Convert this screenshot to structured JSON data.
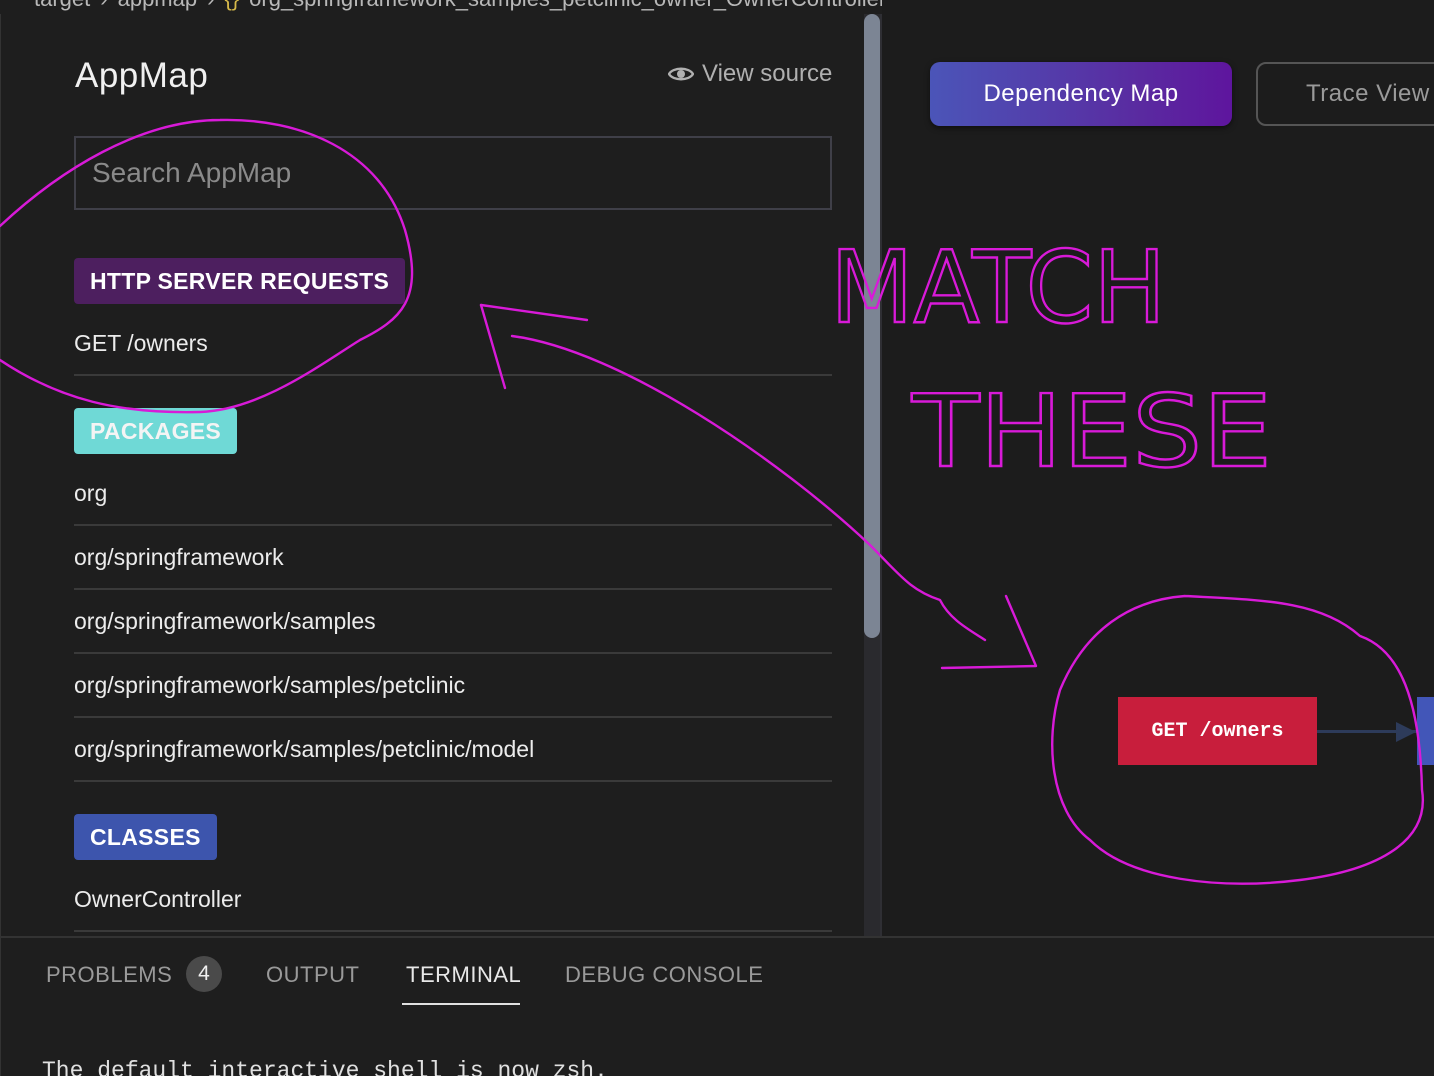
{
  "breadcrumb": {
    "parts": [
      "target",
      "appmap"
    ],
    "file": "org_springframework_samples_petclinic_owner_OwnerControllerTests_testProcessFindForm"
  },
  "appmap": {
    "title": "AppMap",
    "view_source": "View source",
    "search_placeholder": "Search AppMap"
  },
  "sections": {
    "http": {
      "label": "HTTP SERVER REQUESTS",
      "items": [
        "GET /owners"
      ]
    },
    "packages": {
      "label": "PACKAGES",
      "items": [
        "org",
        "org/springframework",
        "org/springframework/samples",
        "org/springframework/samples/petclinic",
        "org/springframework/samples/petclinic/model"
      ]
    },
    "classes": {
      "label": "CLASSES",
      "items": [
        "OwnerController"
      ]
    }
  },
  "views": {
    "dependency_map": "Dependency Map",
    "trace_view": "Trace View"
  },
  "diagram": {
    "node_label": "GET /owners"
  },
  "bottom_panel": {
    "tabs": {
      "problems": "PROBLEMS",
      "problems_count": "4",
      "output": "OUTPUT",
      "terminal": "TERMINAL",
      "debug_console": "DEBUG CONSOLE"
    },
    "terminal_line": "The default interactive shell is now zsh."
  },
  "annotation": {
    "line1": "MATCH",
    "line2": "THESE",
    "color": "#d81ad8"
  },
  "colors": {
    "http_badge": "#4d1f5f",
    "packages_badge": "#6fd9d6",
    "classes_badge": "#3d55ad",
    "http_node": "#c81e3c",
    "class_node": "#4256b8"
  }
}
